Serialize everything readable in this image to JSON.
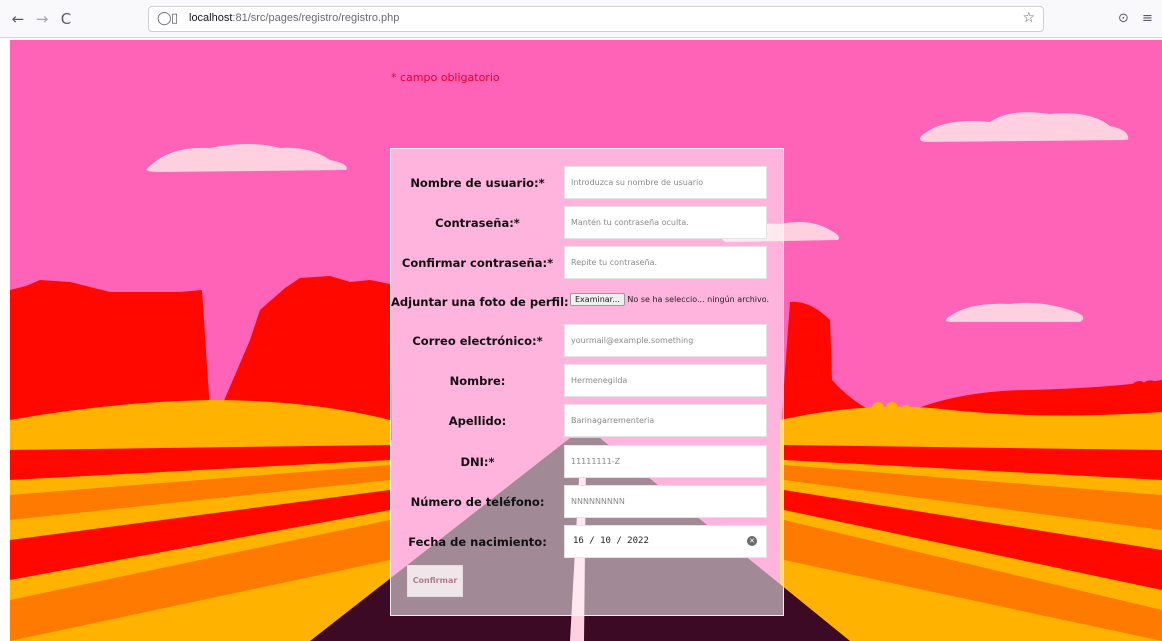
{
  "browser": {
    "back_icon": "←",
    "forward_icon": "→",
    "reload_icon": "C",
    "shield_icon": "◯",
    "page_icon": "▯",
    "url_host": "localhost",
    "url_rest": ":81/src/pages/registro/registro.php",
    "star_icon": "☆",
    "pocket_icon": "⊙",
    "menu_icon": "≡"
  },
  "colors": {
    "sky": "#ff63b8",
    "cloud": "#ffd0df",
    "rock_red": "#ff0800",
    "orange": "#ff7a00",
    "yellow": "#ffb300",
    "road": "#3d0a25",
    "accent_required": "#e8002a"
  },
  "form": {
    "required_note": "* campo obligatorio",
    "fields": [
      {
        "label": "Nombre de usuario:*",
        "placeholder": "Introduzca su nombre de usuario"
      },
      {
        "label": "Contraseña:*",
        "placeholder": "Mantén tu contraseña oculta."
      },
      {
        "label": "Confirmar contraseña:*",
        "placeholder": "Repite tu contraseña."
      },
      {
        "label": "Adjuntar una foto de perfil:",
        "file_button": "Examinar...",
        "file_status": "No se ha seleccio... ningún archivo."
      },
      {
        "label": "Correo electrónico:*",
        "placeholder": "yourmail@example.something"
      },
      {
        "label": "Nombre:",
        "placeholder": "Hermenegilda"
      },
      {
        "label": "Apellido:",
        "placeholder": "Barinagarrementeria"
      },
      {
        "label": "DNI:*",
        "placeholder": "11111111-Z"
      },
      {
        "label": "Número de teléfono:",
        "placeholder": "NNNNNNNNN"
      },
      {
        "label": "Fecha de nacimiento:",
        "value": "16 / 10 / 2022"
      }
    ],
    "submit_label": "Confirmar"
  }
}
